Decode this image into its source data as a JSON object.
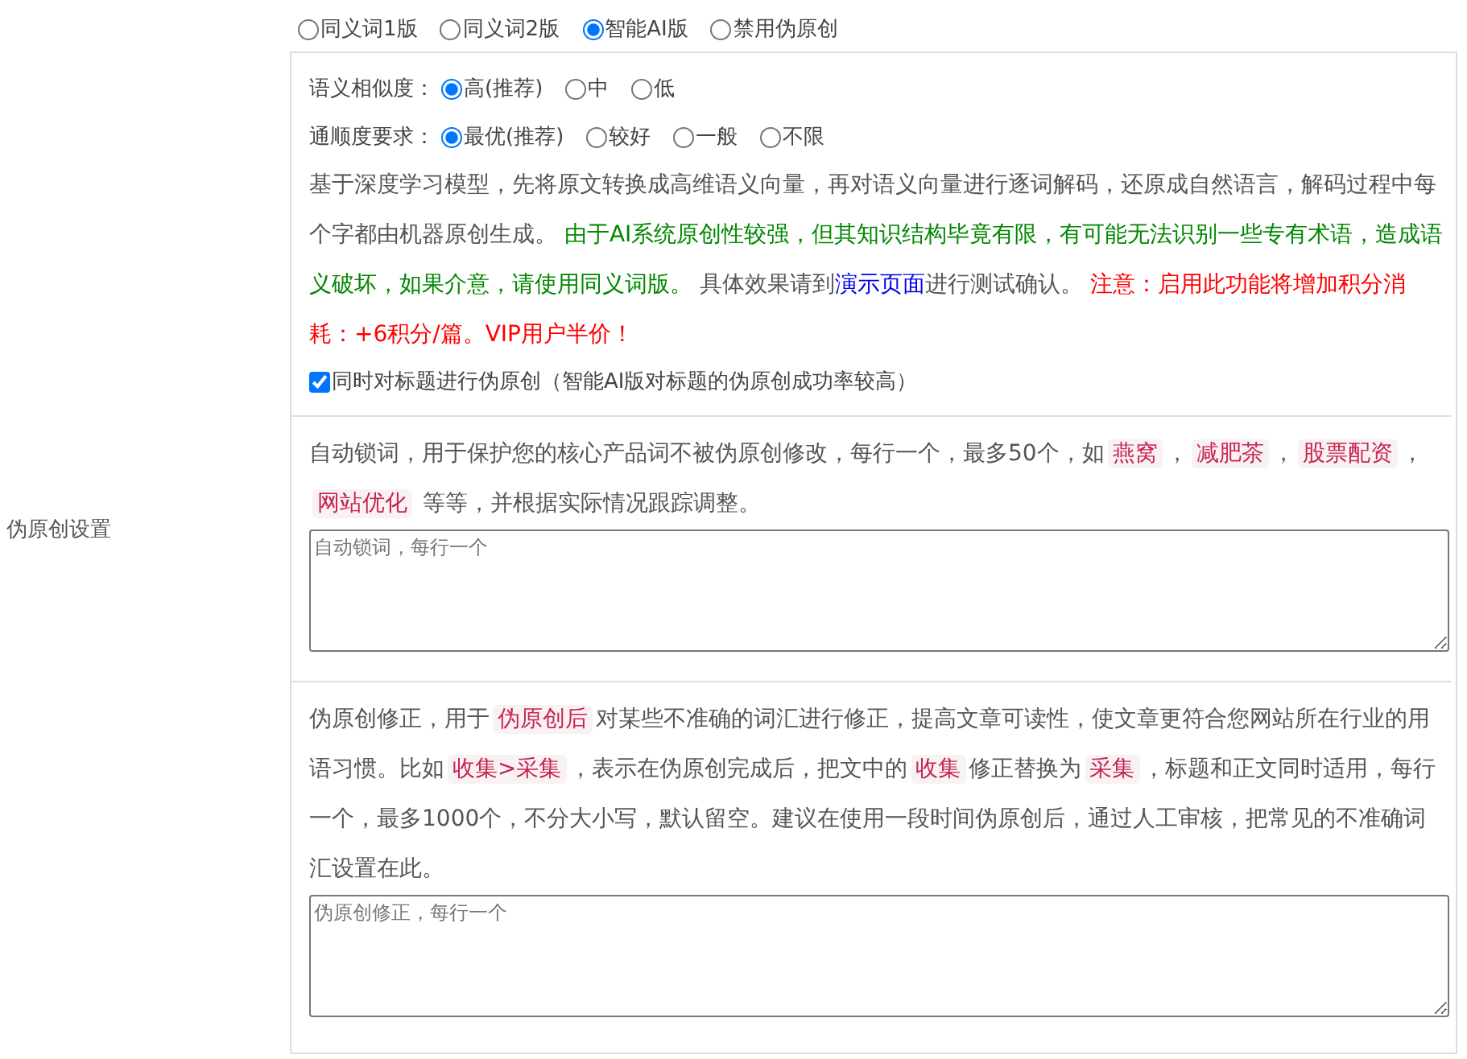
{
  "label": "伪原创设置",
  "modes": [
    {
      "label": "同义词1版",
      "selected": false
    },
    {
      "label": "同义词2版",
      "selected": false
    },
    {
      "label": "智能AI版",
      "selected": true
    },
    {
      "label": "禁用伪原创",
      "selected": false
    }
  ],
  "options": [
    {
      "label": "语义相似度：",
      "choices": [
        {
          "label": "高(推荐)",
          "selected": true
        },
        {
          "label": "中",
          "selected": false
        },
        {
          "label": "低",
          "selected": false
        }
      ]
    },
    {
      "label": "通顺度要求：",
      "choices": [
        {
          "label": "最优(推荐)",
          "selected": true
        },
        {
          "label": "较好",
          "selected": false
        },
        {
          "label": "一般",
          "selected": false
        },
        {
          "label": "不限",
          "selected": false
        }
      ]
    }
  ],
  "description": [
    {
      "kind": "plain",
      "text": "基于深度学习模型，先将原文转换成高维语义向量，再对语义向量进行逐词解码，还原成自然语言，解码过程中每个字都由机器原创生成。 "
    },
    {
      "kind": "green",
      "text": "由于AI系统原创性较强，但其知识结构毕竟有限，有可能无法识别一些专有术语，造成语义破坏，如果介意，请使用同义词版。"
    },
    {
      "kind": "plain",
      "text": " 具体效果请到"
    },
    {
      "kind": "link",
      "text": "演示页面"
    },
    {
      "kind": "plain",
      "text": "进行测试确认。 "
    },
    {
      "kind": "red",
      "text": "注意：启用此功能将增加积分消耗：+6积分/篇。VIP用户半价！"
    }
  ],
  "title_option": {
    "label": "同时对标题进行伪原创（智能AI版对标题的伪原创成功率较高）",
    "checked": true
  },
  "lock_words": {
    "description": [
      {
        "kind": "plain",
        "text": "自动锁词，用于保护您的核心产品词不被伪原创修改，每行一个，最多50个，如"
      },
      {
        "kind": "tag",
        "text": "燕窝"
      },
      {
        "kind": "plain",
        "text": "，"
      },
      {
        "kind": "tag",
        "text": "减肥茶"
      },
      {
        "kind": "plain",
        "text": "，"
      },
      {
        "kind": "tag",
        "text": "股票配资"
      },
      {
        "kind": "plain",
        "text": "，"
      },
      {
        "kind": "tag",
        "text": "网站优化"
      },
      {
        "kind": "plain",
        "text": " 等等，并根据实际情况跟踪调整。"
      }
    ],
    "placeholder": "自动锁词，每行一个"
  },
  "corrections": {
    "description": [
      {
        "kind": "plain",
        "text": "伪原创修正，用于"
      },
      {
        "kind": "tag",
        "text": "伪原创后"
      },
      {
        "kind": "plain",
        "text": "对某些不准确的词汇进行修正，提高文章可读性，使文章更符合您网站所在行业的用语习惯。比如"
      },
      {
        "kind": "tag",
        "text": "收集>采集"
      },
      {
        "kind": "plain",
        "text": "，表示在伪原创完成后，把文中的"
      },
      {
        "kind": "tag",
        "text": "收集"
      },
      {
        "kind": "plain",
        "text": "修正替换为"
      },
      {
        "kind": "tag",
        "text": "采集"
      },
      {
        "kind": "plain",
        "text": "，标题和正文同时适用，每行一个，最多1000个，不分大小写，默认留空。建议在使用一段时间伪原创后，通过人工审核，把常见的不准确词汇设置在此。"
      }
    ],
    "placeholder": "伪原创修正，每行一个"
  }
}
